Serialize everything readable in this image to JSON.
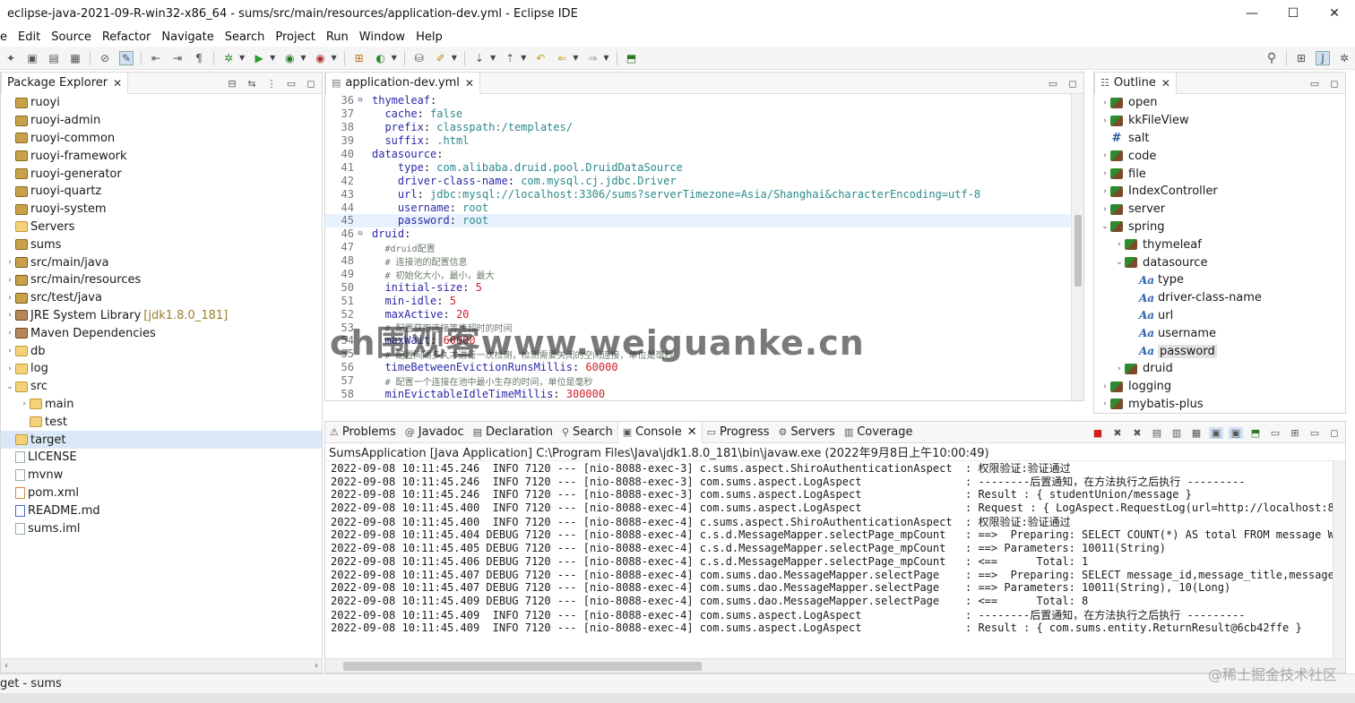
{
  "window": {
    "title": "eclipse-java-2021-09-R-win32-x86_64 - sums/src/main/resources/application-dev.yml - Eclipse IDE",
    "minimize": "—",
    "maximize": "☐",
    "close": "✕"
  },
  "menu": [
    "File",
    "Edit",
    "Source",
    "Refactor",
    "Navigate",
    "Search",
    "Project",
    "Run",
    "Window",
    "Help"
  ],
  "menu_visible": [
    "e",
    "Edit",
    "Source",
    "Refactor",
    "Navigate",
    "Search",
    "Project",
    "Run",
    "Window",
    "Help"
  ],
  "package_explorer": {
    "tab_label": "Package Explorer",
    "items": [
      {
        "label": "ruoyi",
        "icon": "project-icon",
        "twisty": ""
      },
      {
        "label": "ruoyi-admin",
        "icon": "project-icon",
        "twisty": ""
      },
      {
        "label": "ruoyi-common",
        "icon": "project-icon",
        "twisty": ""
      },
      {
        "label": "ruoyi-framework",
        "icon": "project-icon",
        "twisty": ""
      },
      {
        "label": "ruoyi-generator",
        "icon": "project-icon",
        "twisty": ""
      },
      {
        "label": "ruoyi-quartz",
        "icon": "project-icon",
        "twisty": ""
      },
      {
        "label": "ruoyi-system",
        "icon": "project-icon",
        "twisty": ""
      },
      {
        "label": "Servers",
        "icon": "folder-icon",
        "twisty": ""
      },
      {
        "label": "sums",
        "icon": "project-icon",
        "twisty": ""
      },
      {
        "label": "src/main/java",
        "icon": "package-folder-icon",
        "twisty": ">"
      },
      {
        "label": "src/main/resources",
        "icon": "package-folder-icon",
        "twisty": ">"
      },
      {
        "label": "src/test/java",
        "icon": "package-folder-icon",
        "twisty": ">"
      },
      {
        "label": "JRE System Library",
        "suffix": "[jdk1.8.0_181]",
        "icon": "library-icon",
        "twisty": ">"
      },
      {
        "label": "Maven Dependencies",
        "icon": "library-icon",
        "twisty": ">"
      },
      {
        "label": "db",
        "icon": "folder-icon",
        "twisty": ">"
      },
      {
        "label": "log",
        "icon": "folder-icon",
        "twisty": ">"
      },
      {
        "label": "src",
        "icon": "folder-icon",
        "twisty": "v"
      },
      {
        "label": "main",
        "icon": "folder-icon",
        "twisty": ">",
        "indent": 1
      },
      {
        "label": "test",
        "icon": "folder-icon",
        "twisty": "",
        "indent": 1
      },
      {
        "label": "target",
        "icon": "folder-icon",
        "twisty": "",
        "selected": true
      },
      {
        "label": "LICENSE",
        "icon": "file-icon",
        "twisty": ""
      },
      {
        "label": "mvnw",
        "icon": "file-icon",
        "twisty": ""
      },
      {
        "label": "pom.xml",
        "icon": "xml-file-icon",
        "twisty": ""
      },
      {
        "label": "README.md",
        "icon": "md-file-icon",
        "twisty": ""
      },
      {
        "label": "sums.iml",
        "icon": "file-icon",
        "twisty": ""
      }
    ]
  },
  "editor": {
    "tab_label": "application-dev.yml",
    "lines": [
      {
        "n": "36",
        "fold": "⊖",
        "indent": "",
        "parts": [
          [
            "k",
            "thymeleaf"
          ],
          [
            "p",
            ":"
          ]
        ]
      },
      {
        "n": "37",
        "fold": "",
        "indent": "  ",
        "parts": [
          [
            "k",
            "cache"
          ],
          [
            "p",
            ": "
          ],
          [
            "v",
            "false"
          ]
        ]
      },
      {
        "n": "38",
        "fold": "",
        "indent": "  ",
        "parts": [
          [
            "k",
            "prefix"
          ],
          [
            "p",
            ": "
          ],
          [
            "v",
            "classpath:/templates/"
          ]
        ]
      },
      {
        "n": "39",
        "fold": "",
        "indent": "  ",
        "parts": [
          [
            "k",
            "suffix"
          ],
          [
            "p",
            ": "
          ],
          [
            "v",
            ".html"
          ]
        ]
      },
      {
        "n": "40",
        "fold": "",
        "indent": "",
        "parts": [
          [
            "k",
            "datasource"
          ],
          [
            "p",
            ":"
          ]
        ]
      },
      {
        "n": "41",
        "fold": "",
        "indent": "    ",
        "parts": [
          [
            "k",
            "type"
          ],
          [
            "p",
            ": "
          ],
          [
            "v",
            "com.alibaba.druid.pool.DruidDataSource"
          ]
        ]
      },
      {
        "n": "42",
        "fold": "",
        "indent": "    ",
        "parts": [
          [
            "k",
            "driver-class-name"
          ],
          [
            "p",
            ": "
          ],
          [
            "v",
            "com.mysql.cj.jdbc.Driver"
          ]
        ]
      },
      {
        "n": "43",
        "fold": "",
        "indent": "    ",
        "parts": [
          [
            "k",
            "url"
          ],
          [
            "p",
            ": "
          ],
          [
            "v",
            "jdbc:mysql://localhost:3306/sums?serverTimezone=Asia/Shanghai&characterEncoding=utf-8"
          ]
        ]
      },
      {
        "n": "44",
        "fold": "",
        "indent": "    ",
        "parts": [
          [
            "k",
            "username"
          ],
          [
            "p",
            ": "
          ],
          [
            "v",
            "root"
          ]
        ]
      },
      {
        "n": "45",
        "fold": "",
        "indent": "    ",
        "current": true,
        "parts": [
          [
            "k",
            "password"
          ],
          [
            "p",
            ": "
          ],
          [
            "v",
            "root"
          ]
        ]
      },
      {
        "n": "46",
        "fold": "⊖",
        "indent": "",
        "parts": [
          [
            "k",
            "druid"
          ],
          [
            "p",
            ":"
          ]
        ]
      },
      {
        "n": "47",
        "fold": "",
        "indent": "  ",
        "parts": [
          [
            "c",
            "#druid配置"
          ]
        ]
      },
      {
        "n": "48",
        "fold": "",
        "indent": "  ",
        "parts": [
          [
            "c",
            "# 连接池的配置信息"
          ]
        ]
      },
      {
        "n": "49",
        "fold": "",
        "indent": "  ",
        "parts": [
          [
            "c",
            "# 初始化大小，最小，最大"
          ]
        ]
      },
      {
        "n": "50",
        "fold": "",
        "indent": "  ",
        "parts": [
          [
            "k",
            "initial-size"
          ],
          [
            "p",
            ": "
          ],
          [
            "n",
            "5"
          ]
        ]
      },
      {
        "n": "51",
        "fold": "",
        "indent": "  ",
        "parts": [
          [
            "k",
            "min-idle"
          ],
          [
            "p",
            ": "
          ],
          [
            "n",
            "5"
          ]
        ]
      },
      {
        "n": "52",
        "fold": "",
        "indent": "  ",
        "parts": [
          [
            "k",
            "maxActive"
          ],
          [
            "p",
            ": "
          ],
          [
            "n",
            "20"
          ]
        ]
      },
      {
        "n": "53",
        "fold": "",
        "indent": "  ",
        "parts": [
          [
            "c",
            "# 配置获取连接等待超时的时间"
          ]
        ]
      },
      {
        "n": "54",
        "fold": "",
        "indent": "  ",
        "parts": [
          [
            "k",
            "maxWait"
          ],
          [
            "p",
            ": "
          ],
          [
            "n",
            "60000"
          ]
        ]
      },
      {
        "n": "55",
        "fold": "",
        "indent": "  ",
        "parts": [
          [
            "c",
            "# 配置间隔多久才进行一次检测，检测需要关闭的空闲连接，单位是毫秒"
          ]
        ]
      },
      {
        "n": "56",
        "fold": "",
        "indent": "  ",
        "parts": [
          [
            "k",
            "timeBetweenEvictionRunsMillis"
          ],
          [
            "p",
            ": "
          ],
          [
            "n",
            "60000"
          ]
        ]
      },
      {
        "n": "57",
        "fold": "",
        "indent": "  ",
        "parts": [
          [
            "c",
            "# 配置一个连接在池中最小生存的时间，单位是毫秒"
          ]
        ]
      },
      {
        "n": "58",
        "fold": "",
        "indent": "  ",
        "parts": [
          [
            "k",
            "minEvictableIdleTimeMillis"
          ],
          [
            "p",
            ": "
          ],
          [
            "n",
            "300000"
          ]
        ]
      }
    ]
  },
  "outline": {
    "tab_label": "Outline",
    "items": [
      {
        "label": "open",
        "icon": "pkg",
        "twisty": ">",
        "indent": 0
      },
      {
        "label": "kkFileView",
        "icon": "pkg",
        "twisty": ">",
        "indent": 0
      },
      {
        "label": "salt",
        "icon": "hash",
        "twisty": "",
        "indent": 0
      },
      {
        "label": "code",
        "icon": "pkg",
        "twisty": ">",
        "indent": 0
      },
      {
        "label": "file",
        "icon": "pkg",
        "twisty": ">",
        "indent": 0
      },
      {
        "label": "IndexController",
        "icon": "pkg",
        "twisty": ">",
        "indent": 0
      },
      {
        "label": "server",
        "icon": "pkg",
        "twisty": ">",
        "indent": 0
      },
      {
        "label": "spring",
        "icon": "pkg",
        "twisty": "v",
        "indent": 0
      },
      {
        "label": "thymeleaf",
        "icon": "pkg",
        "twisty": ">",
        "indent": 1
      },
      {
        "label": "datasource",
        "icon": "pkg",
        "twisty": "v",
        "indent": 1
      },
      {
        "label": "type",
        "icon": "aa",
        "twisty": "",
        "indent": 2
      },
      {
        "label": "driver-class-name",
        "icon": "aa",
        "twisty": "",
        "indent": 2
      },
      {
        "label": "url",
        "icon": "aa",
        "twisty": "",
        "indent": 2
      },
      {
        "label": "username",
        "icon": "aa",
        "twisty": "",
        "indent": 2
      },
      {
        "label": "password",
        "icon": "aa",
        "twisty": "",
        "indent": 2,
        "selected": true
      },
      {
        "label": "druid",
        "icon": "pkg",
        "twisty": ">",
        "indent": 1
      },
      {
        "label": "logging",
        "icon": "pkg",
        "twisty": ">",
        "indent": 0
      },
      {
        "label": "mybatis-plus",
        "icon": "pkg",
        "twisty": ">",
        "indent": 0
      }
    ]
  },
  "bottom_tabs": [
    {
      "label": "Problems",
      "icon": "⚠"
    },
    {
      "label": "Javadoc",
      "icon": "@"
    },
    {
      "label": "Declaration",
      "icon": "▤"
    },
    {
      "label": "Search",
      "icon": "⚲"
    },
    {
      "label": "Console",
      "icon": "▣",
      "active": true
    },
    {
      "label": "Progress",
      "icon": "▭"
    },
    {
      "label": "Servers",
      "icon": "⚙"
    },
    {
      "label": "Coverage",
      "icon": "▥"
    }
  ],
  "console": {
    "title": "SumsApplication [Java Application] C:\\Program Files\\Java\\jdk1.8.0_181\\bin\\javaw.exe  (2022年9月8日上午10:00:49)",
    "lines": [
      "2022-09-08 10:11:45.246  INFO 7120 --- [nio-8088-exec-3] c.sums.aspect.ShiroAuthenticationAspect  : 权限验证:验证通过",
      "2022-09-08 10:11:45.246  INFO 7120 --- [nio-8088-exec-3] com.sums.aspect.LogAspect                : --------后置通知，在方法执行之后执行 ---------",
      "2022-09-08 10:11:45.246  INFO 7120 --- [nio-8088-exec-3] com.sums.aspect.LogAspect                : Result : { studentUnion/message }",
      "2022-09-08 10:11:45.400  INFO 7120 --- [nio-8088-exec-4] com.sums.aspect.LogAspect                : Request : { LogAspect.RequestLog(url=http://localhost:8088/me",
      "2022-09-08 10:11:45.400  INFO 7120 --- [nio-8088-exec-4] c.sums.aspect.ShiroAuthenticationAspect  : 权限验证:验证通过",
      "2022-09-08 10:11:45.404 DEBUG 7120 --- [nio-8088-exec-4] c.s.d.MessageMapper.selectPage_mpCount   : ==>  Preparing: SELECT COUNT(*) AS total FROM message WHERE (",
      "2022-09-08 10:11:45.405 DEBUG 7120 --- [nio-8088-exec-4] c.s.d.MessageMapper.selectPage_mpCount   : ==> Parameters: 10011(String)",
      "2022-09-08 10:11:45.406 DEBUG 7120 --- [nio-8088-exec-4] c.s.d.MessageMapper.selectPage_mpCount   : <==      Total: 1",
      "2022-09-08 10:11:45.407 DEBUG 7120 --- [nio-8088-exec-4] com.sums.dao.MessageMapper.selectPage    : ==>  Preparing: SELECT message_id,message_title,message_text,",
      "2022-09-08 10:11:45.407 DEBUG 7120 --- [nio-8088-exec-4] com.sums.dao.MessageMapper.selectPage    : ==> Parameters: 10011(String), 10(Long)",
      "2022-09-08 10:11:45.409 DEBUG 7120 --- [nio-8088-exec-4] com.sums.dao.MessageMapper.selectPage    : <==      Total: 8",
      "2022-09-08 10:11:45.409  INFO 7120 --- [nio-8088-exec-4] com.sums.aspect.LogAspect                : --------后置通知，在方法执行之后执行 ---------",
      "2022-09-08 10:11:45.409  INFO 7120 --- [nio-8088-exec-4] com.sums.aspect.LogAspect                : Result : { com.sums.entity.ReturnResult@6cb42ffe }"
    ]
  },
  "status_bar": {
    "text": "get - sums"
  },
  "watermarks": {
    "main": "ch围观客www.weiguanke.cn",
    "corner": "@稀土掘金技术社区"
  },
  "colors": {
    "yaml_key": "#2a2aa8",
    "yaml_value": "#2a8a8a",
    "yaml_number": "#d0202a",
    "selection": "#dbe8f8"
  }
}
